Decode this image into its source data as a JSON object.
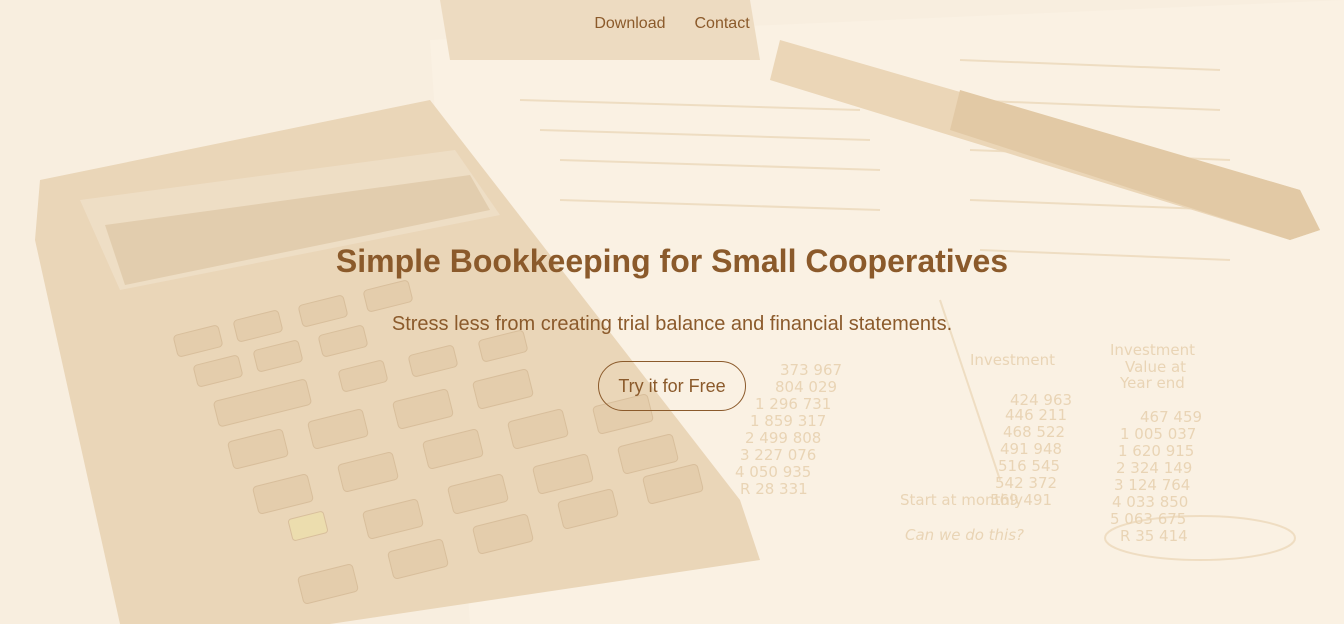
{
  "nav": {
    "items": [
      {
        "label": "Download"
      },
      {
        "label": "Contact"
      }
    ]
  },
  "hero": {
    "title": "Simple Bookkeeping for Small Cooperatives",
    "subtitle": "Stress less from creating trial balance and financial statements.",
    "cta_label": "Try it for Free"
  },
  "colors": {
    "text": "#8b5a2b",
    "background": "#fbf5ec",
    "overlay": "#f3e2c8"
  }
}
